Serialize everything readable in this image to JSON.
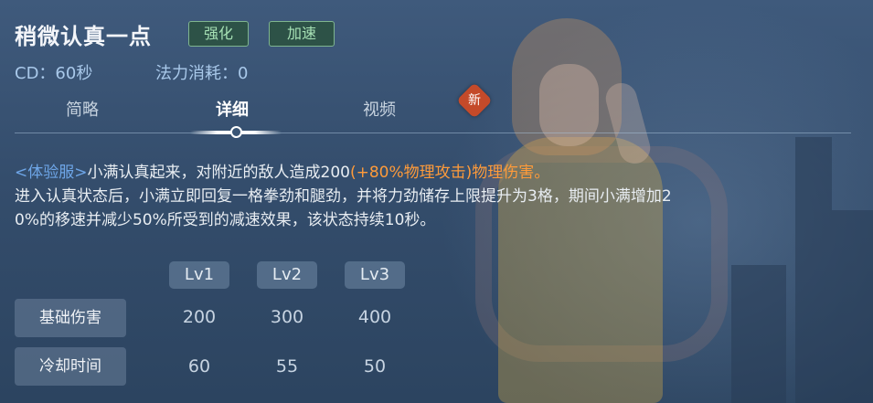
{
  "skill": {
    "name": "稍微认真一点",
    "tags": [
      "强化",
      "加速"
    ],
    "cd": "CD：60秒",
    "mana": "法力消耗：0"
  },
  "tabs": [
    {
      "label": "简略",
      "active": false
    },
    {
      "label": "详细",
      "active": true
    },
    {
      "label": "视频",
      "active": false
    }
  ],
  "new_badge": "新",
  "description": {
    "trial_tag": "<体验服>",
    "line1_a": "小满认真起来，对附近的敌人造成200",
    "line1_bonus": "(+80%物理攻击)",
    "line1_b": "物理伤害。",
    "line2": "进入认真状态后，小满立即回复一格拳劲和腿劲，并将力劲储存上限提升为3格，期间小满增加2",
    "line3": "0%的移速并减少50%所受到的减速效果，该状态持续10秒。"
  },
  "levels": [
    "Lv1",
    "Lv2",
    "Lv3"
  ],
  "rows": [
    {
      "label": "基础伤害",
      "values": [
        "200",
        "300",
        "400"
      ]
    },
    {
      "label": "冷却时间",
      "values": [
        "60",
        "55",
        "50"
      ]
    }
  ],
  "colors": {
    "accent_orange": "#ff9b3a",
    "trial_blue": "#6ea6e8",
    "tag_green": "#a6e0b4"
  }
}
